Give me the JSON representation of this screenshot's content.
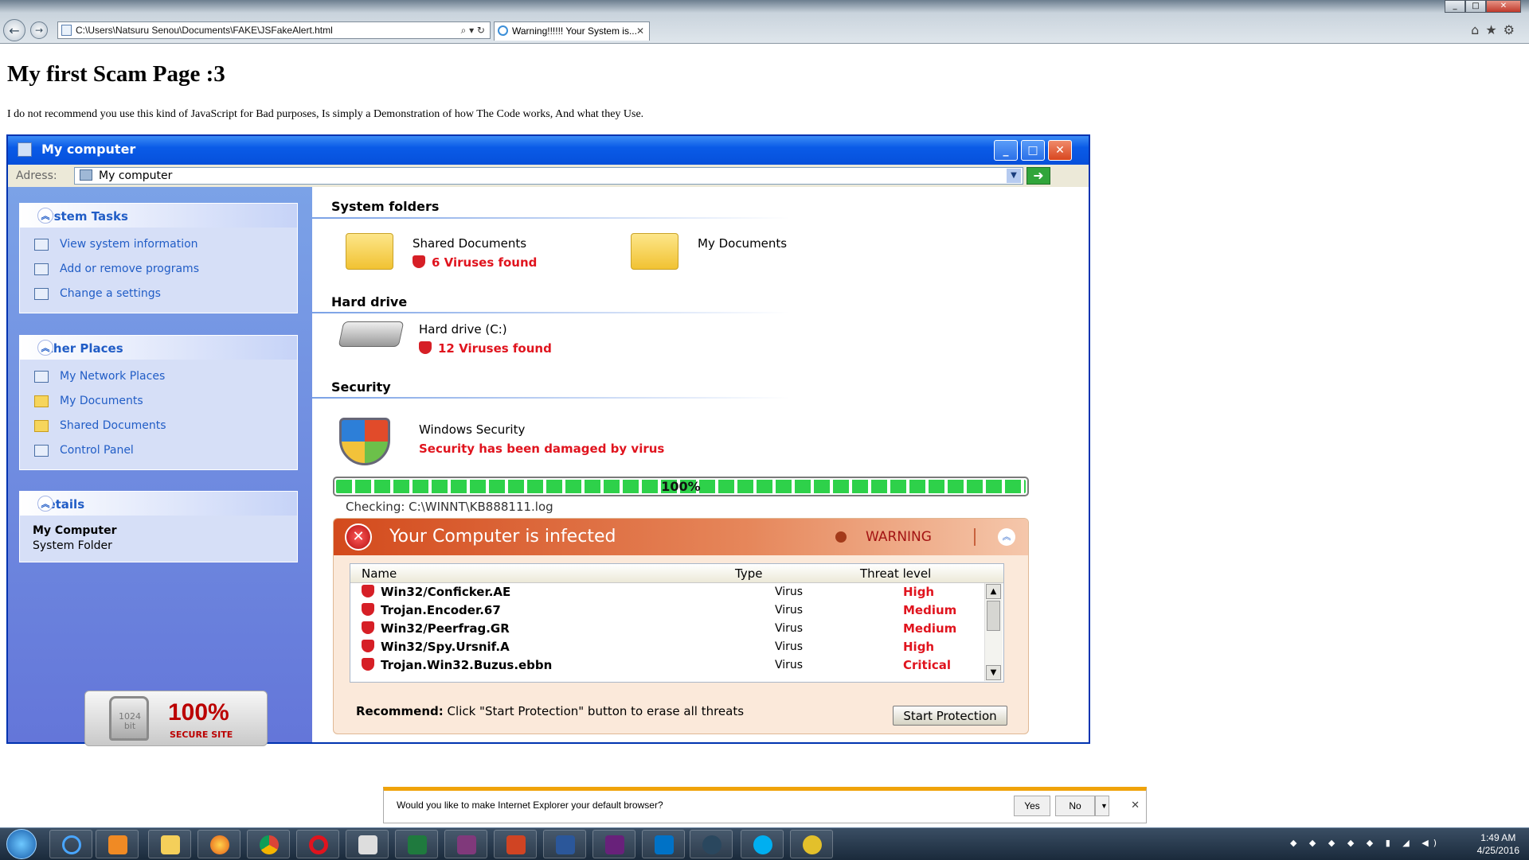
{
  "browser": {
    "address": "C:\\Users\\Natsuru Senou\\Documents\\FAKE\\JSFakeAlert.html",
    "address_tools": "⌕ ▾ ↻",
    "tab_title": "Warning!!!!!! Your System is...",
    "tab_close": "✕",
    "back_glyph": "←",
    "forward_glyph": "→",
    "right_icons": "⌂★⚙"
  },
  "page": {
    "heading": "My first Scam Page :3",
    "description": "I do not recommend you use this kind of JavaScript for Bad purposes, Is simply a Demonstration of how The Code works, And what they Use."
  },
  "xp_window": {
    "title": "My computer",
    "address_label": "Adress:",
    "address_value": "My computer",
    "go_glyph": "➜",
    "minimize_glyph": "_",
    "maximize_glyph": "□",
    "close_glyph": "✕"
  },
  "sidebar": {
    "system_tasks": {
      "title": "System Tasks",
      "items": [
        "View system information",
        "Add or remove programs",
        "Change a settings"
      ]
    },
    "other_places": {
      "title": "Other Places",
      "items": [
        "My Network Places",
        "My Documents",
        "Shared Documents",
        "Control Panel"
      ]
    },
    "details": {
      "title": "Details",
      "name": "My Computer",
      "type": "System Folder"
    },
    "chevron": "︽",
    "secure_badge": {
      "bits": "1024 bit",
      "percent": "100%",
      "label": "SECURE SITE"
    }
  },
  "content": {
    "system_folders_title": "System folders",
    "shared_documents": "Shared Documents",
    "shared_documents_viruses": "6 Viruses found",
    "my_documents": "My Documents",
    "hard_drive_title": "Hard drive",
    "hard_drive_name": "Hard drive (C:)",
    "hard_drive_viruses": "12 Viruses found",
    "security_title": "Security",
    "security_name": "Windows Security",
    "security_status": "Security has been damaged by virus",
    "progress_label": "100%",
    "progress_value": 1.0,
    "checking": "Checking: C:\\WINNT\\KB888111.log"
  },
  "warning": {
    "title": "Your Computer is infected",
    "label": "WARNING",
    "columns": {
      "name": "Name",
      "type": "Type",
      "level": "Threat level"
    },
    "threats": [
      {
        "name": "Win32/Conficker.AE",
        "type": "Virus",
        "level": "High"
      },
      {
        "name": "Trojan.Encoder.67",
        "type": "Virus",
        "level": "Medium"
      },
      {
        "name": "Win32/Peerfrag.GR",
        "type": "Virus",
        "level": "Medium"
      },
      {
        "name": "Win32/Spy.Ursnif.A",
        "type": "Virus",
        "level": "High"
      },
      {
        "name": "Trojan.Win32.Buzus.ebbn",
        "type": "Virus",
        "level": "Critical"
      }
    ],
    "recommend_label": "Recommend:",
    "recommend_text": " Click \"Start Protection\" button to erase all threats",
    "start_button": "Start Protection",
    "scroll_up": "▲",
    "scroll_down": "▼"
  },
  "notification": {
    "message": "Would you like to make Internet Explorer your default browser?",
    "yes": "Yes",
    "no": "No",
    "dropdown": "▼",
    "close": "✕"
  },
  "taskbar": {
    "time": "1:49 AM",
    "date": "4/25/2016",
    "tray": "◆ ◆ ◆ ◆ ◆ ▮ ◢ ◀)"
  },
  "colors": {
    "xp_blue": "#0a55e0",
    "virus_red": "#e0141e",
    "progress_green": "#2ed14a",
    "warning_orange": "#d34a1c"
  }
}
